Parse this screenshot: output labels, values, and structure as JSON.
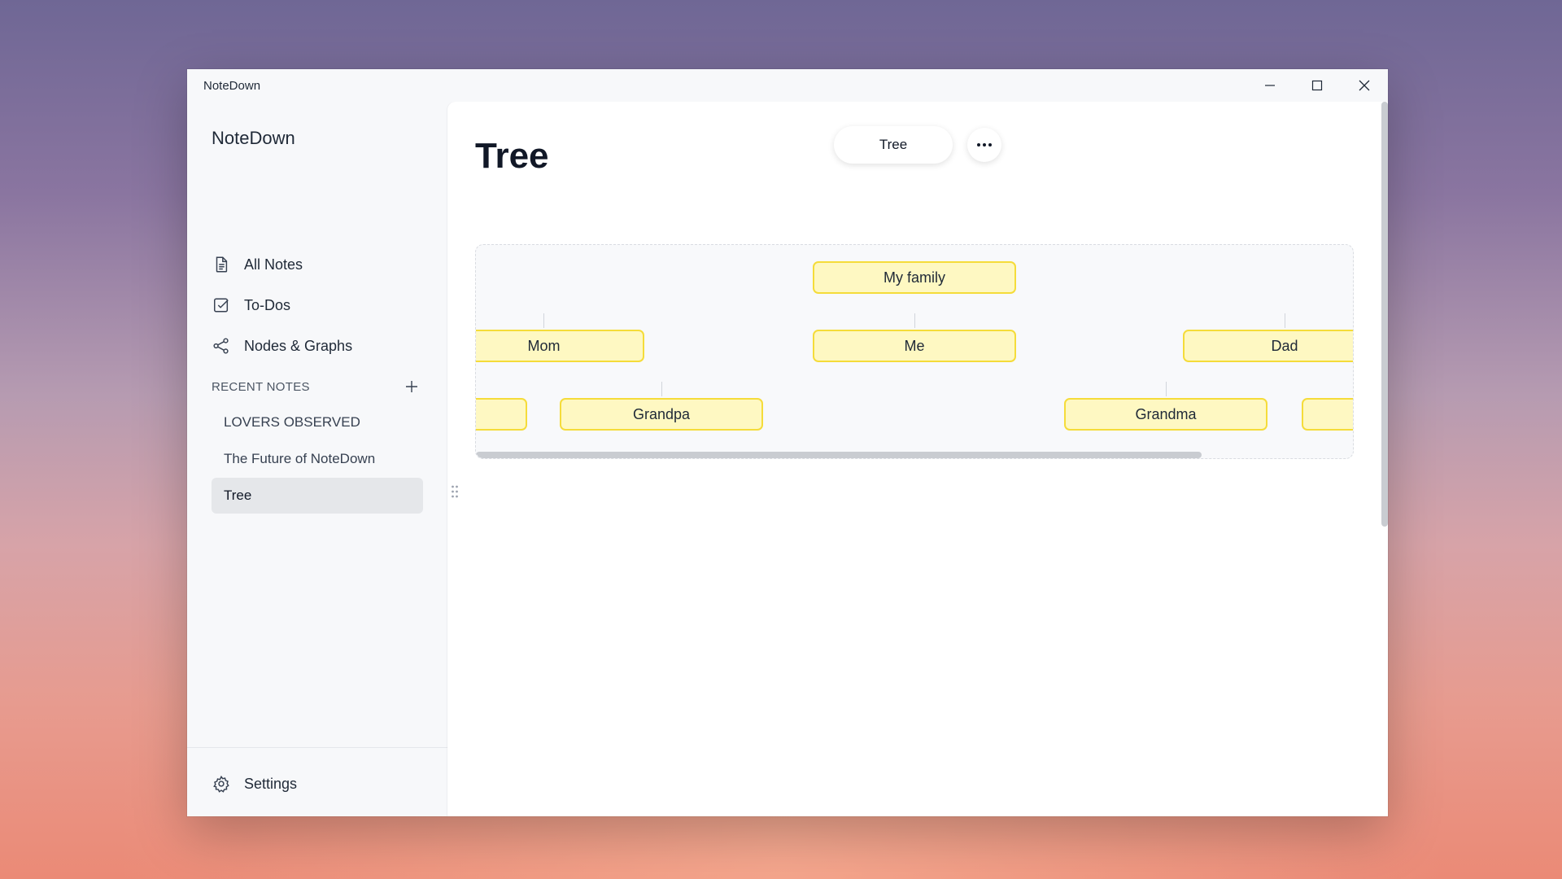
{
  "window": {
    "title": "NoteDown"
  },
  "sidebar": {
    "title": "NoteDown",
    "nav": [
      {
        "label": "All Notes",
        "icon": "document-icon"
      },
      {
        "label": "To-Dos",
        "icon": "checkbox-icon"
      },
      {
        "label": "Nodes & Graphs",
        "icon": "share-nodes-icon"
      }
    ],
    "recent_label": "RECENT NOTES",
    "recent": [
      {
        "label": "LOVERS OBSERVED"
      },
      {
        "label": "The Future of NoteDown"
      },
      {
        "label": "Tree"
      }
    ],
    "settings_label": "Settings"
  },
  "main": {
    "title": "Tree",
    "view_button": "Tree",
    "tree": {
      "root": "My family",
      "level1": [
        "Mom",
        "Me",
        "Dad"
      ],
      "level2": [
        "",
        "Grandpa",
        "Grandma",
        ""
      ]
    }
  },
  "colors": {
    "node_fill": "#fef8c2",
    "node_border": "#f5dc3a",
    "accent": "#111827"
  }
}
